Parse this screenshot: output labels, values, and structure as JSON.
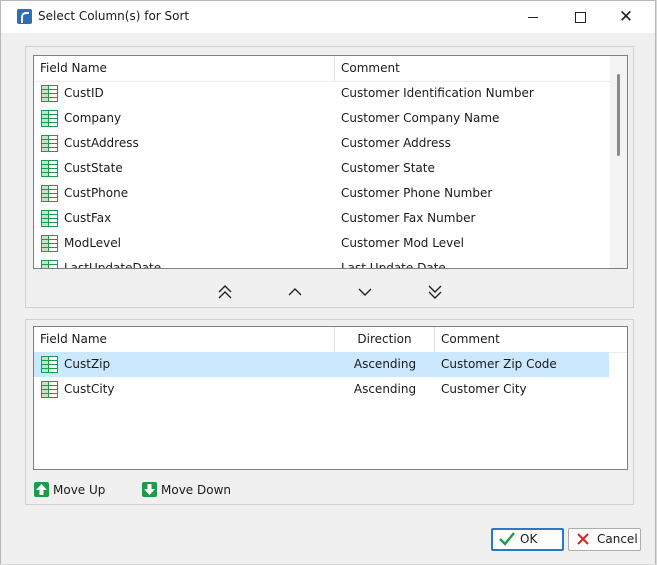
{
  "window": {
    "title": "Select Column(s) for Sort",
    "minimize_icon": "minimize-icon",
    "maximize_icon": "maximize-icon",
    "close_icon": "close-icon"
  },
  "available_columns": {
    "headers": {
      "field_name": "Field Name",
      "comment": "Comment"
    },
    "rows": [
      {
        "field": "CustID",
        "comment": "Customer Identification Number"
      },
      {
        "field": "Company",
        "comment": "Customer Company Name"
      },
      {
        "field": "CustAddress",
        "comment": "Customer Address"
      },
      {
        "field": "CustState",
        "comment": "Customer State"
      },
      {
        "field": "CustPhone",
        "comment": "Customer Phone Number"
      },
      {
        "field": "CustFax",
        "comment": "Customer Fax Number"
      },
      {
        "field": "ModLevel",
        "comment": "Customer Mod Level"
      },
      {
        "field": "LastUpdateDate",
        "comment": "Last Update Date"
      }
    ]
  },
  "transfer_buttons": {
    "icons": [
      "double-chevron-up-icon",
      "chevron-up-icon",
      "chevron-down-icon",
      "double-chevron-down-icon"
    ]
  },
  "sort_columns": {
    "headers": {
      "field_name": "Field Name",
      "direction": "Direction",
      "comment": "Comment"
    },
    "rows": [
      {
        "field": "CustZip",
        "direction": "Ascending",
        "comment": "Customer Zip Code",
        "selected": true
      },
      {
        "field": "CustCity",
        "direction": "Ascending",
        "comment": "Customer City",
        "selected": false
      }
    ]
  },
  "move": {
    "up_label": "Move Up",
    "down_label": "Move Down"
  },
  "buttons": {
    "ok_label": "OK",
    "cancel_label": "Cancel"
  },
  "colors": {
    "accent": "#2a78c8",
    "selected_row": "#cce8ff",
    "table_icon": "#1f9a4a",
    "cancel_icon": "#d42a2a"
  }
}
